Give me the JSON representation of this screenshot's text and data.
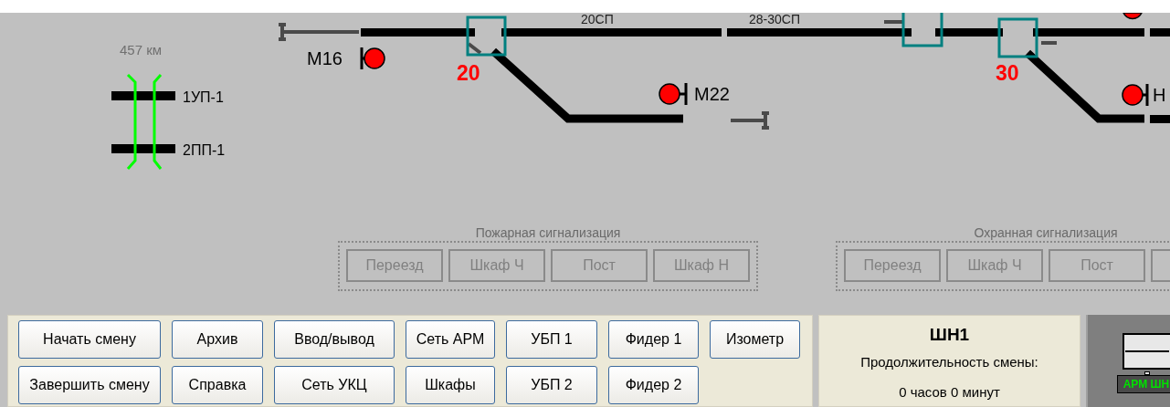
{
  "crossing": {
    "km": "457 км",
    "tracks": [
      "1УП-1",
      "2ПП-1"
    ]
  },
  "section_labels": [
    "20СП",
    "28-30СП"
  ],
  "switches": [
    {
      "number": "20"
    },
    {
      "number": "30"
    }
  ],
  "signals": [
    {
      "label": "М16",
      "color": "#ff0000"
    },
    {
      "label": "М22",
      "color": "#ff0000"
    },
    {
      "label": "Н",
      "color": "#ff0000"
    }
  ],
  "alarm_groups": [
    {
      "title": "Пожарная сигнализация",
      "buttons": [
        {
          "label": "Переезд",
          "disabled": true
        },
        {
          "label": "Шкаф Ч",
          "disabled": true
        },
        {
          "label": "Пост",
          "disabled": true
        },
        {
          "label": "Шкаф Н",
          "disabled": true
        }
      ]
    },
    {
      "title": "Охранная сигнализация",
      "buttons": [
        {
          "label": "Переезд",
          "disabled": true
        },
        {
          "label": "Шкаф Ч",
          "disabled": true
        },
        {
          "label": "Пост",
          "disabled": true
        }
      ]
    }
  ],
  "buttons": [
    [
      "Начать смену",
      "Архив",
      "Ввод/вывод",
      "Сеть АРМ",
      "УБП 1",
      "Фидер 1",
      "Изометр"
    ],
    [
      "Завершить смену",
      "Справка",
      "Сеть УКЦ",
      "Шкафы",
      "УБП 2",
      "Фидер 2"
    ]
  ],
  "shift": {
    "title": "ШН1",
    "duration_label": "Продолжительность смены:",
    "duration": "0 часов 0 минут"
  },
  "workstation": {
    "label": "АРМ ШН"
  }
}
